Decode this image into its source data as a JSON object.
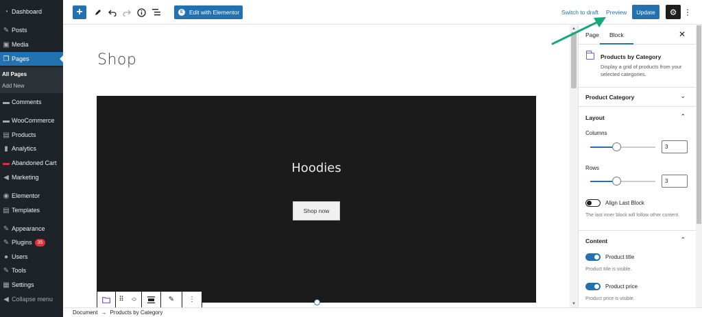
{
  "admin_menu": {
    "items": [
      {
        "label": "Dashboard",
        "icon": "dashboard-icon",
        "glyph": "◔"
      },
      {
        "label": "Posts",
        "icon": "pushpin-icon",
        "glyph": "✎"
      },
      {
        "label": "Media",
        "icon": "media-icon",
        "glyph": "▣"
      },
      {
        "label": "Pages",
        "icon": "pages-icon",
        "glyph": "❐"
      },
      {
        "label": "Comments",
        "icon": "comments-icon",
        "glyph": "▬"
      },
      {
        "label": "WooCommerce",
        "icon": "woocommerce-icon",
        "glyph": "▬"
      },
      {
        "label": "Products",
        "icon": "products-icon",
        "glyph": "▤"
      },
      {
        "label": "Analytics",
        "icon": "analytics-icon",
        "glyph": "▮"
      },
      {
        "label": "Abandoned Cart",
        "icon": "abandoned-cart-icon",
        "glyph": "▬"
      },
      {
        "label": "Marketing",
        "icon": "megaphone-icon",
        "glyph": "◀"
      },
      {
        "label": "Elementor",
        "icon": "elementor-icon",
        "glyph": "◉"
      },
      {
        "label": "Templates",
        "icon": "templates-icon",
        "glyph": "▤"
      },
      {
        "label": "Appearance",
        "icon": "appearance-icon",
        "glyph": "✎"
      },
      {
        "label": "Plugins",
        "icon": "plugins-icon",
        "glyph": "✎",
        "badge": "35"
      },
      {
        "label": "Users",
        "icon": "users-icon",
        "glyph": "●"
      },
      {
        "label": "Tools",
        "icon": "tools-icon",
        "glyph": "✎"
      },
      {
        "label": "Settings",
        "icon": "settings-icon",
        "glyph": "▦"
      },
      {
        "label": "Collapse menu",
        "icon": "collapse-icon",
        "glyph": "◀"
      }
    ],
    "submenu": [
      "All Pages",
      "Add New"
    ]
  },
  "toolbar": {
    "elementor_label": "Edit with Elementor",
    "switch_draft_label": "Switch to draft",
    "preview_label": "Preview",
    "update_label": "Update"
  },
  "canvas": {
    "page_title": "Shop",
    "cover_title": "Hoodies",
    "cover_button": "Shop now"
  },
  "inspector": {
    "tabs": [
      "Page",
      "Block"
    ],
    "block_title": "Products by Category",
    "block_description": "Display a grid of products from your selected categories.",
    "product_category_label": "Product Category",
    "layout_label": "Layout",
    "columns_label": "Columns",
    "columns_value": "3",
    "columns_fraction": 0.4,
    "rows_label": "Rows",
    "rows_value": "3",
    "rows_fraction": 0.4,
    "align_last_label": "Align Last Block",
    "align_last_help": "The last inner block will follow other content.",
    "content_label": "Content",
    "product_title_label": "Product title",
    "product_title_help": "Product title is visible.",
    "product_price_label": "Product price",
    "product_price_help": "Product price is visible."
  },
  "footer": {
    "breadcrumb_root": "Document",
    "breadcrumb_sep": "→",
    "breadcrumb_current": "Products by Category"
  },
  "colors": {
    "admin_bg": "#1d2327",
    "accent": "#2271b1",
    "annotation_arrow": "#15a87b",
    "badge": "#d63638"
  }
}
